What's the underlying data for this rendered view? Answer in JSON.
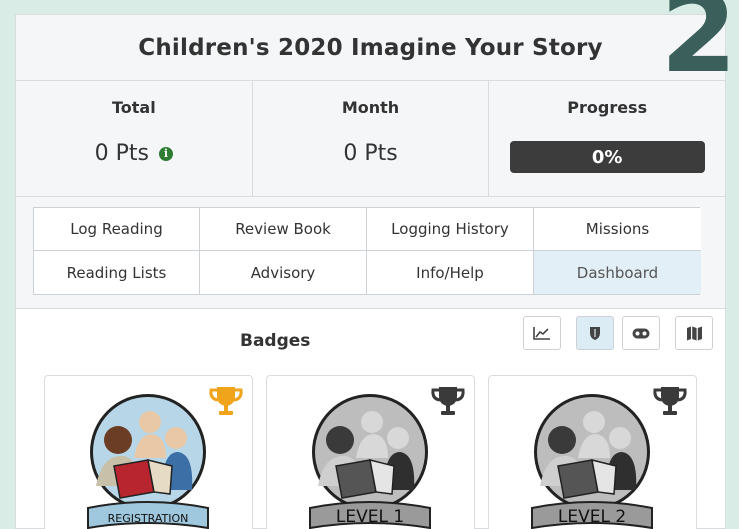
{
  "corner_digit": "2",
  "title": "Children's 2020 Imagine Your Story",
  "stats": {
    "total_label": "Total",
    "total_value": "0 Pts",
    "month_label": "Month",
    "month_value": "0 Pts",
    "progress_label": "Progress",
    "progress_value": "0%",
    "progress_fraction": 0
  },
  "nav": [
    {
      "label": "Log Reading"
    },
    {
      "label": "Review Book"
    },
    {
      "label": "Logging History"
    },
    {
      "label": "Missions"
    },
    {
      "label": "Reading Lists"
    },
    {
      "label": "Advisory"
    },
    {
      "label": "Info/Help"
    },
    {
      "label": "Dashboard",
      "active": true
    }
  ],
  "badges": {
    "title": "Badges",
    "tools": [
      {
        "icon": "line-chart-icon"
      },
      {
        "icon": "shield-icon",
        "active": true
      },
      {
        "icon": "gamepad-icon"
      },
      {
        "icon": "map-icon"
      }
    ],
    "items": [
      {
        "label": "REGISTRATION",
        "earned": true,
        "trophy_color": "#f0a41c"
      },
      {
        "label": "LEVEL 1",
        "earned": false,
        "trophy_color": "#3a3a3a"
      },
      {
        "label": "LEVEL 2",
        "earned": false,
        "trophy_color": "#3a3a3a"
      }
    ]
  },
  "colors": {
    "background": "#d9ede6",
    "progress_bar": "#3c3c3c",
    "info_icon": "#2e7d32",
    "trophy_earned": "#f0a41c",
    "trophy_unearned": "#3a3a3a",
    "active_tab": "#e2eff6"
  }
}
